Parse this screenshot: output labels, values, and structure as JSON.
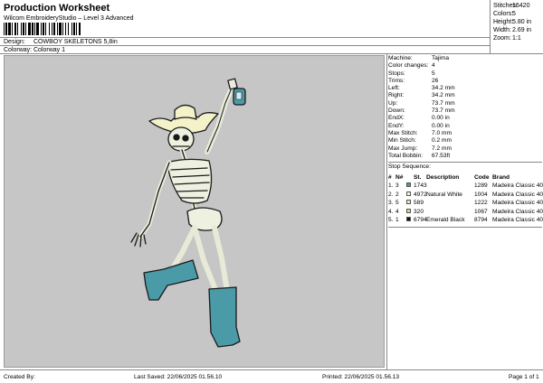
{
  "header": {
    "title": "Production Worksheet",
    "subtitle": "Wilcom EmbroideryStudio – Level 3 Advanced",
    "design_label": "Design:",
    "design_value": "COWBOY SKELETONS 5,8in",
    "colorway_label": "Colorway:",
    "colorway_value": "Colorway 1"
  },
  "stats": [
    {
      "label": "Stitches:",
      "value": "16420"
    },
    {
      "label": "Colors:",
      "value": "5"
    },
    {
      "label": "Height:",
      "value": "5.80 in"
    },
    {
      "label": "Width:",
      "value": "2.69 in"
    },
    {
      "label": "Zoom:",
      "value": "1:1"
    }
  ],
  "machine_info": [
    {
      "label": "Machine:",
      "value": "Tajima"
    },
    {
      "label": "Color changes:",
      "value": "4"
    },
    {
      "label": "Stops:",
      "value": "5"
    },
    {
      "label": "Trims:",
      "value": "26"
    },
    {
      "label": "Left:",
      "value": "34.2 mm"
    },
    {
      "label": "Right:",
      "value": "34.2 mm"
    },
    {
      "label": "Up:",
      "value": "73.7 mm"
    },
    {
      "label": "Down:",
      "value": "73.7 mm"
    },
    {
      "label": "EndX:",
      "value": "0.00 in"
    },
    {
      "label": "EndY:",
      "value": "0.00 in"
    },
    {
      "label": "Max Stitch:",
      "value": "7.0 mm"
    },
    {
      "label": "Min Stitch:",
      "value": "0.2 mm"
    },
    {
      "label": "Max Jump:",
      "value": "7.2 mm"
    },
    {
      "label": "Total Bobbin:",
      "value": "67.53ft"
    }
  ],
  "stop_sequence": {
    "title": "Stop Sequence:",
    "headers": {
      "num": "#",
      "n": "N#",
      "st": "St.",
      "desc": "Description",
      "code": "Code",
      "brand": "Brand"
    },
    "rows": [
      {
        "num": "1.",
        "n": "3",
        "color": "#4a9aa8",
        "st": "1743",
        "desc": "",
        "code": "1289",
        "brand": "Madeira Classic 40"
      },
      {
        "num": "2.",
        "n": "2",
        "color": "#f2f2f2",
        "st": "4972",
        "desc": "Natural White",
        "code": "1004",
        "brand": "Madeira Classic 40"
      },
      {
        "num": "3.",
        "n": "5",
        "color": "#f0e6b0",
        "st": "589",
        "desc": "",
        "code": "1222",
        "brand": "Madeira Classic 40"
      },
      {
        "num": "4.",
        "n": "4",
        "color": "#e9c9a0",
        "st": "320",
        "desc": "",
        "code": "1067",
        "brand": "Madeira Classic 40"
      },
      {
        "num": "5.",
        "n": "1",
        "color": "#111111",
        "st": "6794",
        "desc": "Emerald Black",
        "code": "8794",
        "brand": "Madeira Classic 40"
      }
    ]
  },
  "footer": {
    "created_by": "Created By:",
    "last_saved": "Last Saved: 22/06/2025 01.56.10",
    "printed": "Printed: 22/06/2025 01.56.13",
    "page": "Page 1 of 1"
  }
}
